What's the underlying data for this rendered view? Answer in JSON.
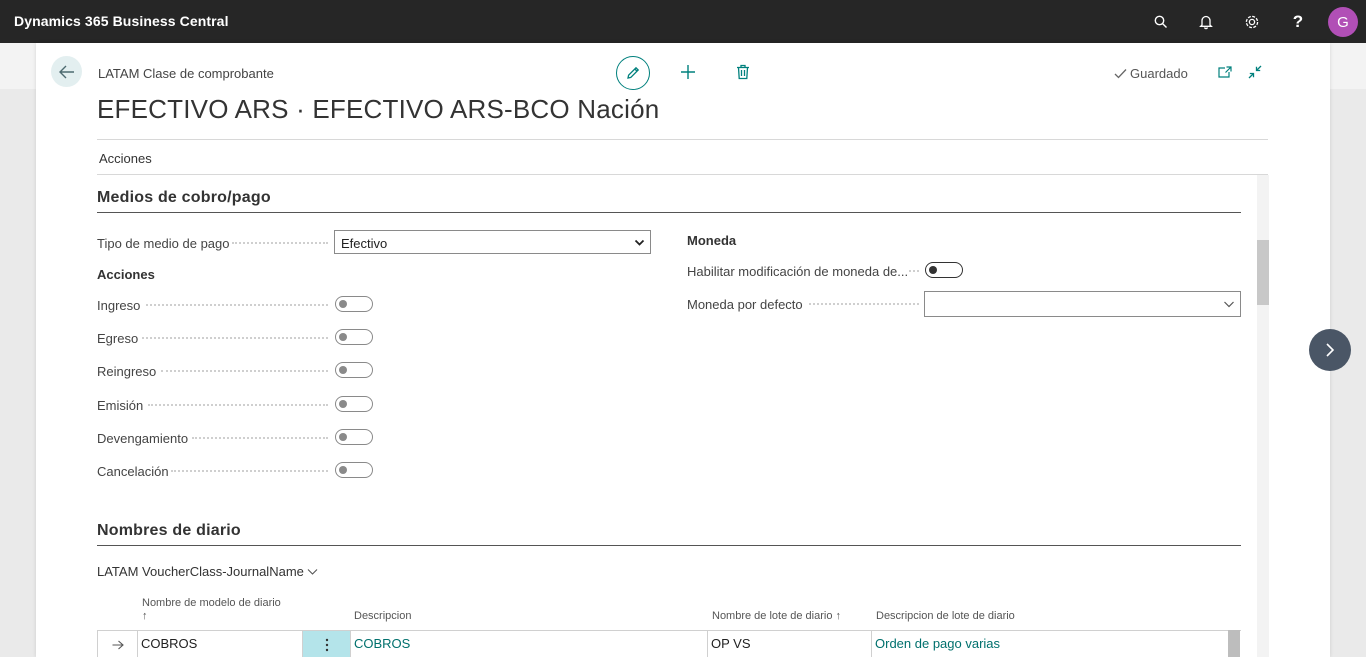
{
  "app": {
    "title": "Dynamics 365 Business Central",
    "user_initial": "G"
  },
  "header": {
    "breadcrumb": "LATAM Clase de comprobante",
    "title": "EFECTIVO ARS · EFECTIVO ARS-BCO Nación",
    "status": "Guardado",
    "menu_acciones": "Acciones"
  },
  "section_medios": {
    "title": "Medios de cobro/pago",
    "tipo_label": "Tipo de medio de pago",
    "tipo_value": "Efectivo",
    "acciones_title": "Acciones",
    "toggles": [
      {
        "label": "Ingreso",
        "on": false
      },
      {
        "label": "Egreso",
        "on": false
      },
      {
        "label": "Reingreso",
        "on": false
      },
      {
        "label": "Emisión",
        "on": false
      },
      {
        "label": "Devengamiento",
        "on": false
      },
      {
        "label": "Cancelación",
        "on": false
      }
    ],
    "moneda_title": "Moneda",
    "habilitar_label": "Habilitar modificación de moneda de...",
    "habilitar_on": false,
    "moneda_defecto_label": "Moneda por defecto",
    "moneda_defecto_value": ""
  },
  "section_diario": {
    "title": "Nombres de diario",
    "subpage_title": "LATAM VoucherClass-JournalName",
    "columns": [
      "Nombre de modelo de diario",
      "Descripcion",
      "Nombre de lote de diario",
      "Descripcion de lote de diario"
    ],
    "sort_arrow": "↑",
    "rows": [
      {
        "modelo": "COBROS",
        "descripcion": "COBROS",
        "lote": "OP VS",
        "descripcion_lote": "Orden de pago varias"
      }
    ]
  },
  "colors": {
    "accent": "#00807d",
    "topbar": "#262626",
    "avatar": "#b14fb6"
  }
}
